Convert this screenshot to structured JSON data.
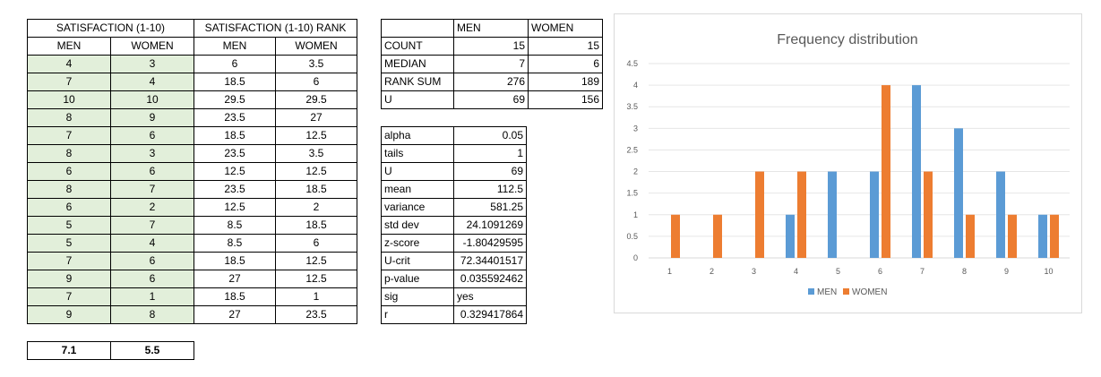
{
  "main_table": {
    "header1": [
      "SATISFACTION (1-10)",
      "SATISFACTION (1-10) RANK"
    ],
    "header2": [
      "MEN",
      "WOMEN",
      "MEN",
      "WOMEN"
    ],
    "rows": [
      [
        "4",
        "3",
        "6",
        "3.5"
      ],
      [
        "7",
        "4",
        "18.5",
        "6"
      ],
      [
        "10",
        "10",
        "29.5",
        "29.5"
      ],
      [
        "8",
        "9",
        "23.5",
        "27"
      ],
      [
        "7",
        "6",
        "18.5",
        "12.5"
      ],
      [
        "8",
        "3",
        "23.5",
        "3.5"
      ],
      [
        "6",
        "6",
        "12.5",
        "12.5"
      ],
      [
        "8",
        "7",
        "23.5",
        "18.5"
      ],
      [
        "6",
        "2",
        "12.5",
        "2"
      ],
      [
        "5",
        "7",
        "8.5",
        "18.5"
      ],
      [
        "5",
        "4",
        "8.5",
        "6"
      ],
      [
        "7",
        "6",
        "18.5",
        "12.5"
      ],
      [
        "9",
        "6",
        "27",
        "12.5"
      ],
      [
        "7",
        "1",
        "18.5",
        "1"
      ],
      [
        "9",
        "8",
        "27",
        "23.5"
      ]
    ]
  },
  "averages": [
    "7.1",
    "5.5"
  ],
  "summary_table": {
    "header": [
      "",
      "MEN",
      "WOMEN"
    ],
    "rows": [
      [
        "COUNT",
        "15",
        "15"
      ],
      [
        "MEDIAN",
        "7",
        "6"
      ],
      [
        "RANK SUM",
        "276",
        "189"
      ],
      [
        "U",
        "69",
        "156"
      ]
    ]
  },
  "stats_table": {
    "rows": [
      [
        "alpha",
        "0.05"
      ],
      [
        "tails",
        "1"
      ],
      [
        "U",
        "69"
      ],
      [
        "mean",
        "112.5"
      ],
      [
        "variance",
        "581.25"
      ],
      [
        "std dev",
        "24.1091269"
      ],
      [
        "z-score",
        "-1.80429595"
      ],
      [
        "U-crit",
        "72.34401517"
      ],
      [
        "p-value",
        "0.035592462"
      ],
      [
        "sig",
        "yes"
      ],
      [
        "r",
        "0.329417864"
      ]
    ]
  },
  "chart_data": {
    "type": "bar",
    "title": "Frequency distribution",
    "categories": [
      "1",
      "2",
      "3",
      "4",
      "5",
      "6",
      "7",
      "8",
      "9",
      "10"
    ],
    "series": [
      {
        "name": "MEN",
        "color": "#5b9bd5",
        "values": [
          0,
          0,
          0,
          1,
          2,
          2,
          4,
          3,
          2,
          1
        ]
      },
      {
        "name": "WOMEN",
        "color": "#ed7d31",
        "values": [
          1,
          1,
          2,
          2,
          0,
          4,
          2,
          1,
          1,
          1
        ]
      }
    ],
    "ylim": [
      0,
      4.5
    ],
    "yticks": [
      "0",
      "0.5",
      "1",
      "1.5",
      "2",
      "2.5",
      "3",
      "3.5",
      "4",
      "4.5"
    ],
    "grid": true,
    "legend": "bottom",
    "xlabel": "",
    "ylabel": ""
  }
}
